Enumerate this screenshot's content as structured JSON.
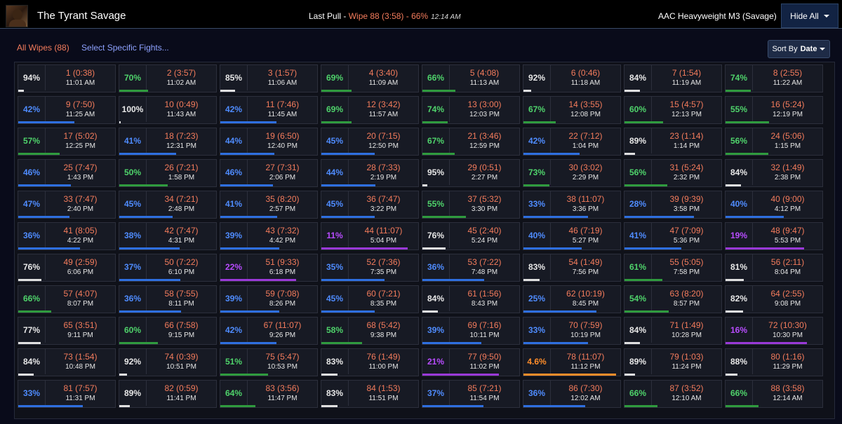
{
  "header": {
    "title": "The Tyrant Savage",
    "last_pull_label": "Last Pull - ",
    "last_pull_wipe": "Wipe 88 (3:58) - 66%",
    "last_pull_time": "12:14 AM",
    "fight_name": "AAC Heavyweight M3 (Savage)",
    "hide_all_label": "Hide All"
  },
  "filters": {
    "all_wipes_label": "All Wipes (88)",
    "select_fights_label": "Select Specific Fights...",
    "sort_by_label": "Sort By",
    "sort_by_value": "Date"
  },
  "colors": {
    "gray": "#e8e8e8",
    "green": "#4fd36b",
    "blue": "#4f8cff",
    "purple": "#b84cff",
    "orange": "#ff8d2a",
    "bar_gray": "#e0e0e0",
    "bar_green": "#2f9b3e",
    "bar_blue": "#2e6fe0",
    "bar_purple": "#9a39d8",
    "bar_orange": "#ff8d2a"
  },
  "pulls": [
    {
      "pct": "94%",
      "label": "1 (0:38)",
      "time": "11:01 AM",
      "color": "gray",
      "progress": 0.06
    },
    {
      "pct": "70%",
      "label": "2 (3:57)",
      "time": "11:02 AM",
      "color": "green",
      "progress": 0.3
    },
    {
      "pct": "85%",
      "label": "3 (1:57)",
      "time": "11:06 AM",
      "color": "gray",
      "progress": 0.15
    },
    {
      "pct": "69%",
      "label": "4 (3:40)",
      "time": "11:09 AM",
      "color": "green",
      "progress": 0.31
    },
    {
      "pct": "66%",
      "label": "5 (4:08)",
      "time": "11:13 AM",
      "color": "green",
      "progress": 0.34
    },
    {
      "pct": "92%",
      "label": "6 (0:46)",
      "time": "11:18 AM",
      "color": "gray",
      "progress": 0.08
    },
    {
      "pct": "84%",
      "label": "7 (1:54)",
      "time": "11:19 AM",
      "color": "gray",
      "progress": 0.16
    },
    {
      "pct": "74%",
      "label": "8 (2:55)",
      "time": "11:22 AM",
      "color": "green",
      "progress": 0.26
    },
    {
      "pct": "42%",
      "label": "9 (7:50)",
      "time": "11:25 AM",
      "color": "blue",
      "progress": 0.58
    },
    {
      "pct": "100%",
      "label": "10 (0:49)",
      "time": "11:43 AM",
      "color": "gray",
      "progress": 0.0
    },
    {
      "pct": "42%",
      "label": "11 (7:46)",
      "time": "11:45 AM",
      "color": "blue",
      "progress": 0.58
    },
    {
      "pct": "69%",
      "label": "12 (3:42)",
      "time": "11:57 AM",
      "color": "green",
      "progress": 0.31
    },
    {
      "pct": "74%",
      "label": "13 (3:00)",
      "time": "12:03 PM",
      "color": "green",
      "progress": 0.26
    },
    {
      "pct": "67%",
      "label": "14 (3:55)",
      "time": "12:08 PM",
      "color": "green",
      "progress": 0.33
    },
    {
      "pct": "60%",
      "label": "15 (4:57)",
      "time": "12:13 PM",
      "color": "green",
      "progress": 0.4
    },
    {
      "pct": "55%",
      "label": "16 (5:24)",
      "time": "12:19 PM",
      "color": "green",
      "progress": 0.45
    },
    {
      "pct": "57%",
      "label": "17 (5:02)",
      "time": "12:25 PM",
      "color": "green",
      "progress": 0.43
    },
    {
      "pct": "41%",
      "label": "18 (7:23)",
      "time": "12:31 PM",
      "color": "blue",
      "progress": 0.59
    },
    {
      "pct": "44%",
      "label": "19 (6:50)",
      "time": "12:40 PM",
      "color": "blue",
      "progress": 0.56
    },
    {
      "pct": "45%",
      "label": "20 (7:15)",
      "time": "12:50 PM",
      "color": "blue",
      "progress": 0.55
    },
    {
      "pct": "67%",
      "label": "21 (3:46)",
      "time": "12:59 PM",
      "color": "green",
      "progress": 0.33
    },
    {
      "pct": "42%",
      "label": "22 (7:12)",
      "time": "1:04 PM",
      "color": "blue",
      "progress": 0.58
    },
    {
      "pct": "89%",
      "label": "23 (1:14)",
      "time": "1:14 PM",
      "color": "gray",
      "progress": 0.11
    },
    {
      "pct": "56%",
      "label": "24 (5:06)",
      "time": "1:15 PM",
      "color": "green",
      "progress": 0.44
    },
    {
      "pct": "46%",
      "label": "25 (7:47)",
      "time": "1:43 PM",
      "color": "blue",
      "progress": 0.54
    },
    {
      "pct": "50%",
      "label": "26 (7:21)",
      "time": "1:58 PM",
      "color": "green",
      "progress": 0.5
    },
    {
      "pct": "46%",
      "label": "27 (7:31)",
      "time": "2:06 PM",
      "color": "blue",
      "progress": 0.54
    },
    {
      "pct": "44%",
      "label": "28 (7:33)",
      "time": "2:19 PM",
      "color": "blue",
      "progress": 0.56
    },
    {
      "pct": "95%",
      "label": "29 (0:51)",
      "time": "2:27 PM",
      "color": "gray",
      "progress": 0.05
    },
    {
      "pct": "73%",
      "label": "30 (3:02)",
      "time": "2:29 PM",
      "color": "green",
      "progress": 0.27
    },
    {
      "pct": "56%",
      "label": "31 (5:24)",
      "time": "2:32 PM",
      "color": "green",
      "progress": 0.44
    },
    {
      "pct": "84%",
      "label": "32 (1:49)",
      "time": "2:38 PM",
      "color": "gray",
      "progress": 0.16
    },
    {
      "pct": "47%",
      "label": "33 (7:47)",
      "time": "2:40 PM",
      "color": "blue",
      "progress": 0.53
    },
    {
      "pct": "45%",
      "label": "34 (7:21)",
      "time": "2:48 PM",
      "color": "blue",
      "progress": 0.55
    },
    {
      "pct": "41%",
      "label": "35 (8:20)",
      "time": "2:57 PM",
      "color": "blue",
      "progress": 0.59
    },
    {
      "pct": "45%",
      "label": "36 (7:47)",
      "time": "3:22 PM",
      "color": "blue",
      "progress": 0.55
    },
    {
      "pct": "55%",
      "label": "37 (5:32)",
      "time": "3:30 PM",
      "color": "green",
      "progress": 0.45
    },
    {
      "pct": "33%",
      "label": "38 (11:07)",
      "time": "3:36 PM",
      "color": "blue",
      "progress": 0.67
    },
    {
      "pct": "28%",
      "label": "39 (9:39)",
      "time": "3:58 PM",
      "color": "blue",
      "progress": 0.72
    },
    {
      "pct": "40%",
      "label": "40 (9:00)",
      "time": "4:12 PM",
      "color": "blue",
      "progress": 0.6
    },
    {
      "pct": "36%",
      "label": "41 (8:05)",
      "time": "4:22 PM",
      "color": "blue",
      "progress": 0.64
    },
    {
      "pct": "38%",
      "label": "42 (7:47)",
      "time": "4:31 PM",
      "color": "blue",
      "progress": 0.62
    },
    {
      "pct": "39%",
      "label": "43 (7:32)",
      "time": "4:42 PM",
      "color": "blue",
      "progress": 0.61
    },
    {
      "pct": "11%",
      "label": "44 (11:07)",
      "time": "5:04 PM",
      "color": "purple",
      "progress": 0.89
    },
    {
      "pct": "76%",
      "label": "45 (2:40)",
      "time": "5:24 PM",
      "color": "gray",
      "progress": 0.24
    },
    {
      "pct": "40%",
      "label": "46 (7:19)",
      "time": "5:27 PM",
      "color": "blue",
      "progress": 0.6
    },
    {
      "pct": "41%",
      "label": "47 (7:09)",
      "time": "5:36 PM",
      "color": "blue",
      "progress": 0.59
    },
    {
      "pct": "19%",
      "label": "48 (9:47)",
      "time": "5:53 PM",
      "color": "purple",
      "progress": 0.81
    },
    {
      "pct": "76%",
      "label": "49 (2:59)",
      "time": "6:06 PM",
      "color": "gray",
      "progress": 0.24
    },
    {
      "pct": "37%",
      "label": "50 (7:22)",
      "time": "6:10 PM",
      "color": "blue",
      "progress": 0.63
    },
    {
      "pct": "22%",
      "label": "51 (9:33)",
      "time": "6:18 PM",
      "color": "purple",
      "progress": 0.78
    },
    {
      "pct": "35%",
      "label": "52 (7:36)",
      "time": "7:35 PM",
      "color": "blue",
      "progress": 0.65
    },
    {
      "pct": "36%",
      "label": "53 (7:22)",
      "time": "7:48 PM",
      "color": "blue",
      "progress": 0.64
    },
    {
      "pct": "83%",
      "label": "54 (1:49)",
      "time": "7:56 PM",
      "color": "gray",
      "progress": 0.17
    },
    {
      "pct": "61%",
      "label": "55 (5:05)",
      "time": "7:58 PM",
      "color": "green",
      "progress": 0.39
    },
    {
      "pct": "81%",
      "label": "56 (2:11)",
      "time": "8:04 PM",
      "color": "gray",
      "progress": 0.19
    },
    {
      "pct": "66%",
      "label": "57 (4:07)",
      "time": "8:07 PM",
      "color": "green",
      "progress": 0.34
    },
    {
      "pct": "36%",
      "label": "58 (7:55)",
      "time": "8:11 PM",
      "color": "blue",
      "progress": 0.64
    },
    {
      "pct": "39%",
      "label": "59 (7:08)",
      "time": "8:26 PM",
      "color": "blue",
      "progress": 0.61
    },
    {
      "pct": "45%",
      "label": "60 (7:21)",
      "time": "8:35 PM",
      "color": "blue",
      "progress": 0.55
    },
    {
      "pct": "84%",
      "label": "61 (1:56)",
      "time": "8:43 PM",
      "color": "gray",
      "progress": 0.16
    },
    {
      "pct": "25%",
      "label": "62 (10:19)",
      "time": "8:45 PM",
      "color": "blue",
      "progress": 0.75
    },
    {
      "pct": "54%",
      "label": "63 (8:20)",
      "time": "8:57 PM",
      "color": "green",
      "progress": 0.46
    },
    {
      "pct": "82%",
      "label": "64 (2:55)",
      "time": "9:08 PM",
      "color": "gray",
      "progress": 0.18
    },
    {
      "pct": "77%",
      "label": "65 (3:51)",
      "time": "9:11 PM",
      "color": "gray",
      "progress": 0.23
    },
    {
      "pct": "60%",
      "label": "66 (7:58)",
      "time": "9:15 PM",
      "color": "green",
      "progress": 0.4
    },
    {
      "pct": "42%",
      "label": "67 (11:07)",
      "time": "9:26 PM",
      "color": "blue",
      "progress": 0.58
    },
    {
      "pct": "58%",
      "label": "68 (5:42)",
      "time": "9:38 PM",
      "color": "green",
      "progress": 0.42
    },
    {
      "pct": "39%",
      "label": "69 (7:16)",
      "time": "10:11 PM",
      "color": "blue",
      "progress": 0.61
    },
    {
      "pct": "33%",
      "label": "70 (7:59)",
      "time": "10:19 PM",
      "color": "blue",
      "progress": 0.67
    },
    {
      "pct": "84%",
      "label": "71 (1:49)",
      "time": "10:28 PM",
      "color": "gray",
      "progress": 0.16
    },
    {
      "pct": "16%",
      "label": "72 (10:30)",
      "time": "10:30 PM",
      "color": "purple",
      "progress": 0.84
    },
    {
      "pct": "84%",
      "label": "73 (1:54)",
      "time": "10:48 PM",
      "color": "gray",
      "progress": 0.16
    },
    {
      "pct": "92%",
      "label": "74 (0:39)",
      "time": "10:51 PM",
      "color": "gray",
      "progress": 0.08
    },
    {
      "pct": "51%",
      "label": "75 (5:47)",
      "time": "10:53 PM",
      "color": "green",
      "progress": 0.49
    },
    {
      "pct": "83%",
      "label": "76 (1:49)",
      "time": "11:00 PM",
      "color": "gray",
      "progress": 0.17
    },
    {
      "pct": "21%",
      "label": "77 (9:50)",
      "time": "11:02 PM",
      "color": "purple",
      "progress": 0.79
    },
    {
      "pct": "4.6%",
      "label": "78 (11:07)",
      "time": "11:12 PM",
      "color": "orange",
      "progress": 0.954
    },
    {
      "pct": "89%",
      "label": "79 (1:03)",
      "time": "11:24 PM",
      "color": "gray",
      "progress": 0.11
    },
    {
      "pct": "88%",
      "label": "80 (1:16)",
      "time": "11:29 PM",
      "color": "gray",
      "progress": 0.12
    },
    {
      "pct": "33%",
      "label": "81 (7:57)",
      "time": "11:31 PM",
      "color": "blue",
      "progress": 0.67
    },
    {
      "pct": "89%",
      "label": "82 (0:59)",
      "time": "11:41 PM",
      "color": "gray",
      "progress": 0.11
    },
    {
      "pct": "64%",
      "label": "83 (3:56)",
      "time": "11:47 PM",
      "color": "green",
      "progress": 0.36
    },
    {
      "pct": "83%",
      "label": "84 (1:53)",
      "time": "11:51 PM",
      "color": "gray",
      "progress": 0.17
    },
    {
      "pct": "37%",
      "label": "85 (7:21)",
      "time": "11:54 PM",
      "color": "blue",
      "progress": 0.63
    },
    {
      "pct": "36%",
      "label": "86 (7:30)",
      "time": "12:02 AM",
      "color": "blue",
      "progress": 0.64
    },
    {
      "pct": "66%",
      "label": "87 (3:52)",
      "time": "12:10 AM",
      "color": "green",
      "progress": 0.34
    },
    {
      "pct": "66%",
      "label": "88 (3:58)",
      "time": "12:14 AM",
      "color": "green",
      "progress": 0.34
    }
  ]
}
